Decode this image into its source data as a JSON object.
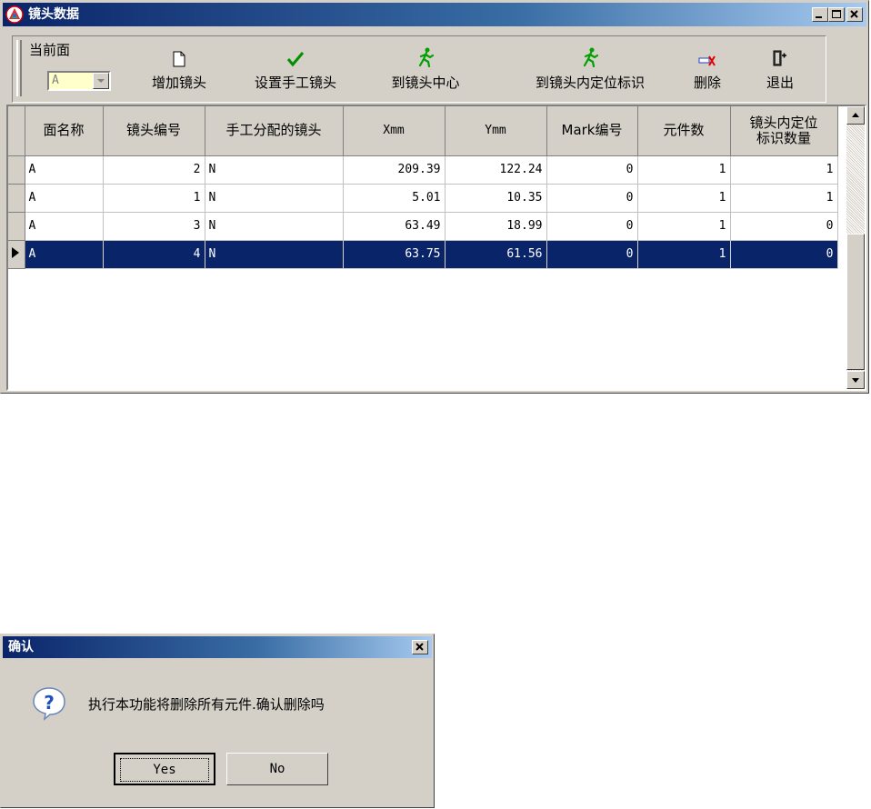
{
  "main_window": {
    "title": "镜头数据",
    "toolbar": {
      "current_face_label": "当前面",
      "current_face_value": "A",
      "buttons": [
        {
          "label": "增加镜头",
          "icon": "new-page-icon"
        },
        {
          "label": "设置手工镜头",
          "icon": "checkmark-icon"
        },
        {
          "label": "到镜头中心",
          "icon": "running-man-icon"
        },
        {
          "label": "到镜头内定位标识",
          "icon": "running-man-icon"
        },
        {
          "label": "删除",
          "icon": "delete-icon"
        },
        {
          "label": "退出",
          "icon": "exit-door-icon"
        }
      ]
    },
    "table": {
      "headers": [
        "面名称",
        "镜头编号",
        "手工分配的镜头",
        "Xmm",
        "Ymm",
        "Mark编号",
        "元件数",
        "镜头内定位\n标识数量"
      ],
      "rows": [
        {
          "face": "A",
          "lens_no": "2",
          "manual": "N",
          "x": "209.39",
          "y": "122.24",
          "mark": "0",
          "parts": "1",
          "markers": "1"
        },
        {
          "face": "A",
          "lens_no": "1",
          "manual": "N",
          "x": "5.01",
          "y": "10.35",
          "mark": "0",
          "parts": "1",
          "markers": "1"
        },
        {
          "face": "A",
          "lens_no": "3",
          "manual": "N",
          "x": "63.49",
          "y": "18.99",
          "mark": "0",
          "parts": "1",
          "markers": "0"
        },
        {
          "face": "A",
          "lens_no": "4",
          "manual": "N",
          "x": "63.75",
          "y": "61.56",
          "mark": "0",
          "parts": "1",
          "markers": "0"
        }
      ],
      "selected_row": 3
    }
  },
  "dialog": {
    "title": "确认",
    "message": "执行本功能将删除所有元件.确认删除吗",
    "yes_label": "Yes",
    "no_label": "No"
  },
  "colors": {
    "title_bar": "#0a246a",
    "selection": "#0a246a",
    "window_face": "#d4d0c8",
    "combo_bg": "#ffffcc",
    "icon_green": "#00a000"
  }
}
